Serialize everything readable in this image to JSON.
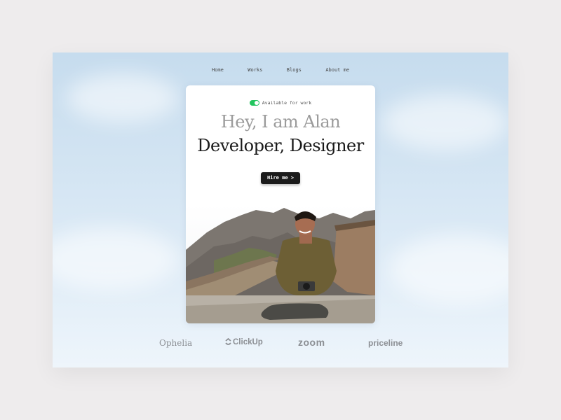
{
  "nav": {
    "items": [
      {
        "label": "Home"
      },
      {
        "label": "Works"
      },
      {
        "label": "Blogs"
      },
      {
        "label": "About me"
      }
    ]
  },
  "hero": {
    "availability": "Available for work",
    "heading_line1": "Hey, I am Alan",
    "heading_line2": "Developer, Designer",
    "cta_label": "Hire me >",
    "photo_icon": "portrait-photo"
  },
  "logos": {
    "items": [
      {
        "label": "Ophelia"
      },
      {
        "label": "ClickUp"
      },
      {
        "label": "zoom"
      },
      {
        "label": "priceline"
      }
    ]
  },
  "colors": {
    "accent": "#22c55e",
    "button": "#1b1b1b",
    "heading_muted": "#9b9b9b",
    "heading_dark": "#1a1a1a",
    "logo_gray": "#8c8f94"
  }
}
